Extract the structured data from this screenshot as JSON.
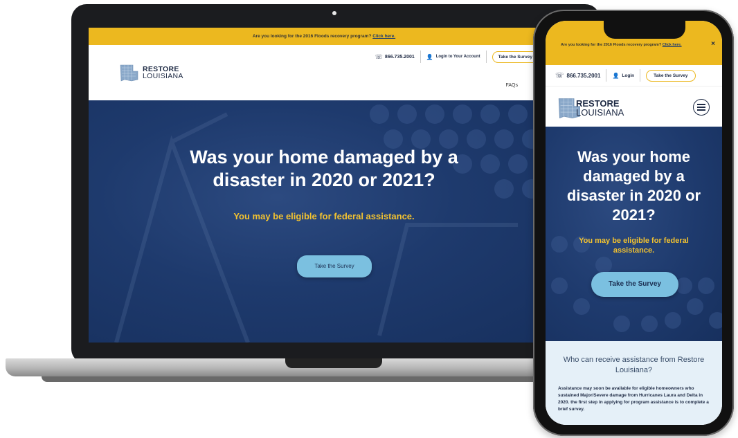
{
  "site": {
    "logo_line1": "RESTORE",
    "logo_line2": "LOUISIANA",
    "topbar_text": "Are you looking for the 2016 Floods recovery program?",
    "topbar_link": "Click here.",
    "phone_number": "866.735.2001",
    "close_icon": "×"
  },
  "laptop": {
    "login_label": "Login to Your Account",
    "survey_label": "Take the Survey",
    "nav_faqs": "FAQs",
    "hero_title": "Was your home damaged by a disaster in 2020 or 2021?",
    "hero_subtitle": "You may be eligible for federal assistance.",
    "hero_button": "Take the Survey"
  },
  "phone": {
    "login_label": "Login",
    "survey_label": "Take the Survey",
    "hero_title": "Was your home damaged by a disaster in 2020 or 2021?",
    "hero_subtitle": "You may be eligible for federal assistance.",
    "hero_button": "Take the Survey",
    "info_heading": "Who can receive assistance from Restore Louisiana?",
    "info_body": "Assistance may soon be available for eligible homeowners who sustained Major/Severe damage from Hurricanes Laura and Delta in 2020. the first step in applying for program assistance is to complete a brief survey."
  },
  "colors": {
    "accent_yellow": "#ecb81f",
    "hero_blue": "#1e3a6d",
    "button_blue": "#7bc0e0"
  },
  "icons": [
    "phone-icon",
    "user-icon",
    "menu-icon",
    "close-icon",
    "louisiana-map-icon"
  ]
}
